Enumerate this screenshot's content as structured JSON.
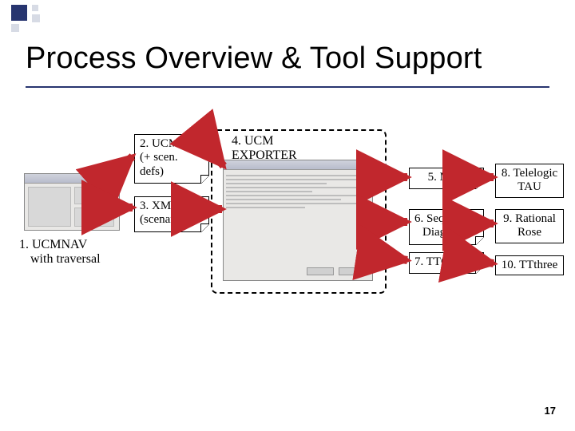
{
  "title": "Process Overview & Tool Support",
  "page_number": "17",
  "caption1_line1": "1. UCMNAV",
  "caption1_line2": "with traversal",
  "note2_line1": "2. UCM File",
  "note2_line2": "(+ scen. defs)",
  "note3_line1": "3. XML File",
  "note3_line2": "(scenarios)",
  "dash_label_line1": "4. UCM",
  "dash_label_line2": "EXPORTER",
  "note5": "5. MSC",
  "note6_line1": "6. Sequence",
  "note6_line2": "Diagram",
  "note7": "7. TTCN -3",
  "box8_line1": "8. Telelogic",
  "box8_line2": "TAU",
  "box9_line1": "9. Rational",
  "box9_line2": "Rose",
  "box10": "10. TTthree"
}
